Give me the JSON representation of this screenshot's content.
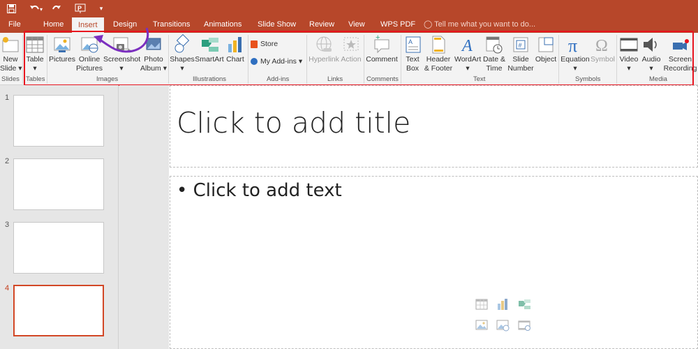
{
  "quick_access": {
    "save": "Save",
    "undo": "Undo",
    "redo": "Redo",
    "start": "From Beginning",
    "customize": "▾"
  },
  "tabs": [
    {
      "label": "File"
    },
    {
      "label": "Home"
    },
    {
      "label": "Insert"
    },
    {
      "label": "Design"
    },
    {
      "label": "Transitions"
    },
    {
      "label": "Animations"
    },
    {
      "label": "Slide Show"
    },
    {
      "label": "Review"
    },
    {
      "label": "View"
    },
    {
      "label": "WPS PDF"
    }
  ],
  "tell_me": "Tell me what you want to do...",
  "ribbon": {
    "slides": {
      "new_slide_1": "New",
      "new_slide_2": "Slide ▾",
      "group": "Slides"
    },
    "tables": {
      "table": "Table",
      "table_arrow": "▾",
      "group": "Tables"
    },
    "images": {
      "pictures": "Pictures",
      "online_pictures_1": "Online",
      "online_pictures_2": "Pictures",
      "screenshot_1": "Screenshot",
      "screenshot_2": "▾",
      "photo_album_1": "Photo",
      "photo_album_2": "Album ▾",
      "group": "Images"
    },
    "illustrations": {
      "shapes": "Shapes",
      "shapes_arrow": "▾",
      "smartart": "SmartArt",
      "chart": "Chart",
      "group": "Illustrations"
    },
    "addins": {
      "store": "Store",
      "my_addins": "My Add-ins ▾",
      "group": "Add-ins"
    },
    "links": {
      "hyperlink": "Hyperlink",
      "action": "Action",
      "group": "Links"
    },
    "comments": {
      "comment": "Comment",
      "group": "Comments"
    },
    "text": {
      "textbox_1": "Text",
      "textbox_2": "Box",
      "header_1": "Header",
      "header_2": "& Footer",
      "wordart": "WordArt",
      "wordart_arrow": "▾",
      "datetime_1": "Date &",
      "datetime_2": "Time",
      "slidenum_1": "Slide",
      "slidenum_2": "Number",
      "object": "Object",
      "group": "Text"
    },
    "symbols": {
      "equation": "Equation",
      "equation_arrow": "▾",
      "symbol": "Symbol",
      "group": "Symbols"
    },
    "media": {
      "video": "Video",
      "video_arrow": "▾",
      "audio": "Audio",
      "audio_arrow": "▾",
      "screen_1": "Screen",
      "screen_2": "Recording",
      "group": "Media"
    }
  },
  "slides": [
    {
      "number": "1"
    },
    {
      "number": "2"
    },
    {
      "number": "3"
    },
    {
      "number": "4"
    }
  ],
  "editor": {
    "title_placeholder": "Click to add title",
    "body_placeholder": "• Click to add text"
  },
  "colors": {
    "accent": "#b7472a",
    "highlight": "#e8141f",
    "annotation_arrow": "#7b2fbf"
  }
}
